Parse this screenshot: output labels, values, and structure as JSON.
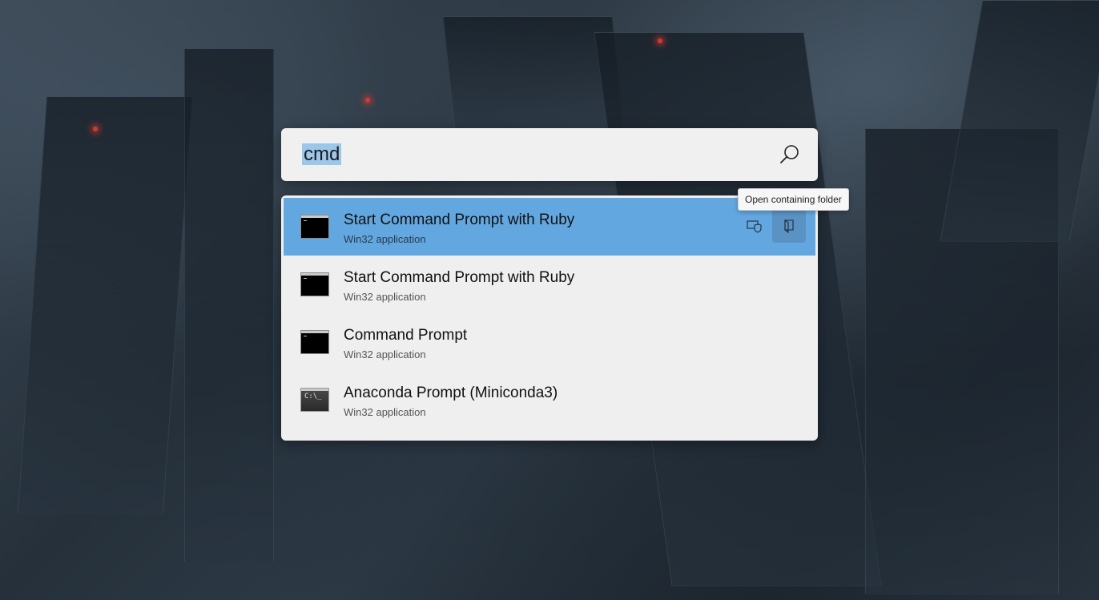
{
  "search": {
    "query": "cmd"
  },
  "results": [
    {
      "title": "Start Command Prompt with Ruby",
      "subtitle": "Win32 application",
      "icon": "cmd-console-icon",
      "selected": true
    },
    {
      "title": "Start Command Prompt with Ruby",
      "subtitle": "Win32 application",
      "icon": "cmd-console-icon",
      "selected": false
    },
    {
      "title": "Command Prompt",
      "subtitle": "Win32 application",
      "icon": "cmd-console-icon",
      "selected": false
    },
    {
      "title": "Anaconda Prompt (Miniconda3)",
      "subtitle": "Win32 application",
      "icon": "anaconda-console-icon",
      "selected": false
    }
  ],
  "context_actions": [
    {
      "name": "run-as-admin",
      "icon": "shield-icon"
    },
    {
      "name": "open-containing-folder",
      "icon": "folder-icon"
    }
  ],
  "tooltip": {
    "text": "Open containing folder"
  },
  "colors": {
    "selected_row": "#63a7e0",
    "selection_highlight": "#9cc6ea",
    "panel_bg": "#efefef"
  }
}
